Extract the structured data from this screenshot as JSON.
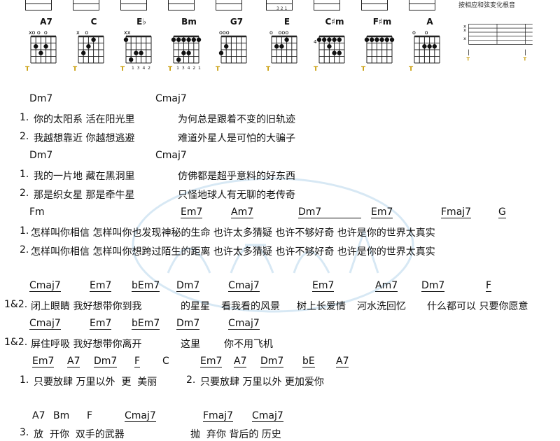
{
  "header": {
    "caption": "按相应和弦变化根音",
    "top_fingers": [
      "3 2 1"
    ]
  },
  "chords": [
    {
      "name": "A7",
      "open": "xo o  o",
      "fingers": "",
      "t": "T"
    },
    {
      "name": "C",
      "open": "x   o",
      "fingers": "",
      "t": "T"
    },
    {
      "name": "E♭",
      "open": "xx",
      "fingers": "1 3 4 2",
      "t": "T"
    },
    {
      "name": "Bm",
      "open": "",
      "fingers": "1 3 4 2 1",
      "t": "T"
    },
    {
      "name": "G7",
      "open": "ooo",
      "fingers": "",
      "t": "T"
    },
    {
      "name": "E",
      "open": "o   ooo",
      "fingers": "",
      "t": "T"
    },
    {
      "name": "C♯m",
      "open": "",
      "fingers": "",
      "t": "T",
      "fret": "4"
    },
    {
      "name": "F♯m",
      "open": "",
      "fingers": "",
      "t": "T"
    },
    {
      "name": "A",
      "open": "o     o",
      "fingers": "",
      "t": "T"
    }
  ],
  "tab": {
    "strings": [
      "x",
      "x",
      "x"
    ],
    "t_marks": [
      "T",
      "T"
    ]
  },
  "sections": [
    {
      "chords": [
        "Dm7",
        "Cmaj7"
      ]
    },
    {
      "num": "1.",
      "lyrics": [
        "你的太阳系 活在阳光里",
        "为何总是跟着不变的旧轨迹"
      ]
    },
    {
      "num": "2.",
      "lyrics": [
        "我越想靠近 你越想逃避",
        "难道外星人是可怕的大骗子"
      ]
    },
    {
      "chords": [
        "Dm7",
        "Cmaj7"
      ]
    },
    {
      "num": "1.",
      "lyrics": [
        "我的一片地 藏在黑洞里",
        "仿佛都是超乎意料的好东西"
      ]
    },
    {
      "num": "2.",
      "lyrics": [
        "那是织女星 那是牵牛星",
        "只怪地球人有无聊的老传奇"
      ]
    },
    {
      "chords": [
        "Fm",
        "Em7",
        "Am7",
        "Dm7",
        "Em7",
        "Fmaj7",
        "G"
      ]
    },
    {
      "num": "1.",
      "lyrics": [
        "怎样叫你相信 怎样叫你也发现神秘的生命 也许太多猜疑 也许不够好奇 也许是你的世界太真实"
      ]
    },
    {
      "num": "2.",
      "lyrics": [
        "怎样叫你相信 怎样叫你想跨过陌生的距离 也许太多猜疑 也许不够好奇 也许是你的世界太真实"
      ]
    },
    {
      "chords": [
        "Cmaj7",
        "Em7",
        "bEm7",
        "Dm7",
        "Cmaj7",
        "Em7",
        "Am7",
        "Dm7",
        "F"
      ]
    },
    {
      "num": "1&2.",
      "lyrics": [
        "闭上眼睛 我好想带你到我",
        "的星星",
        "看我看的风景",
        "树上长爱情",
        "河水洗回忆",
        "什么都可以 只要你愿意"
      ]
    },
    {
      "chords": [
        "Cmaj7",
        "Em7",
        "bEm7",
        "Dm7",
        "Cmaj7"
      ]
    },
    {
      "num": "1&2.",
      "lyrics": [
        "屏住呼吸 我好想带你离开",
        "这里",
        "你不用飞机"
      ]
    },
    {
      "chords": [
        "Em7",
        "A7",
        "Dm7",
        "F",
        "C",
        "Em7",
        "A7",
        "Dm7",
        "bE",
        "A7"
      ]
    },
    {
      "num": "1.",
      "lyrics": [
        "只要放肆 万里以外  更  美丽"
      ]
    },
    {
      "num": "2.",
      "lyrics": [
        "只要放肆 万里以外 更加爱你"
      ]
    },
    {
      "chords": [
        "A7",
        "Bm",
        "F",
        "Cmaj7",
        "Fmaj7",
        "Cmaj7"
      ]
    },
    {
      "num": "3.",
      "lyrics": [
        "放  开你  双手的武器",
        "抛  弃你 背后的 历史"
      ]
    }
  ]
}
